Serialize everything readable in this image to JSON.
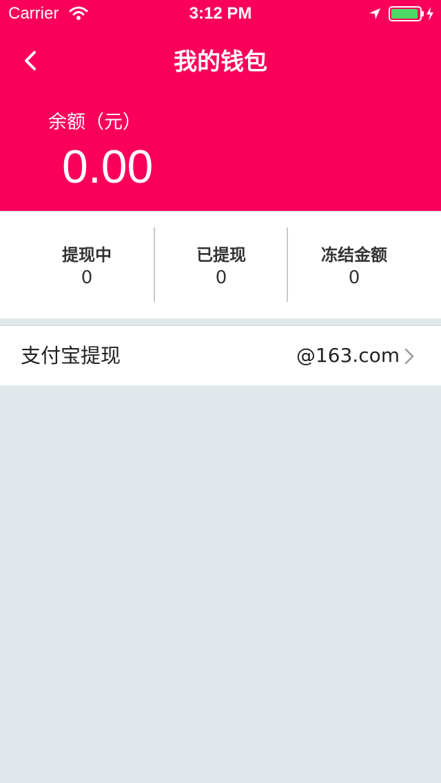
{
  "status_bar": {
    "carrier": "Carrier",
    "time": "3:12 PM",
    "battery_color": "#4cd964"
  },
  "nav": {
    "title": "我的钱包",
    "back_icon": "chevron-left-icon"
  },
  "balance": {
    "label": "余额（元）",
    "value": "0.00"
  },
  "stats": [
    {
      "label": "提现中",
      "value": "0"
    },
    {
      "label": "已提现",
      "value": "0"
    },
    {
      "label": "冻结金额",
      "value": "0"
    }
  ],
  "alipay_row": {
    "label": "支付宝提现",
    "account": "@163.com"
  },
  "colors": {
    "brand": "#fa005a",
    "background": "#e0e8eb"
  }
}
